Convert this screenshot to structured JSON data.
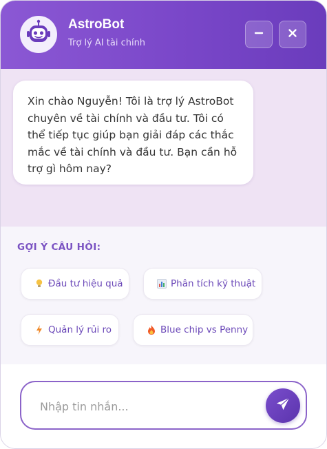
{
  "header": {
    "title": "AstroBot",
    "subtitle": "Trợ lý AI tài chính",
    "avatar_icon": "robot-icon",
    "minimize_icon": "minus-icon",
    "close_icon": "close-icon"
  },
  "messages": [
    {
      "sender": "bot",
      "text": "Xin chào Nguyễn! Tôi là trợ lý AstroBot chuyên về tài chính và đầu tư. Tôi có thể tiếp tục giúp bạn giải đáp các thắc mắc về tài chính và đầu tư. Bạn cần hỗ trợ gì hôm nay?"
    }
  ],
  "suggestions": {
    "label": "GỢI Ý CÂU HỎI:",
    "items": [
      {
        "label": "Đầu tư hiệu quả",
        "icon": "lightbulb-icon"
      },
      {
        "label": "Phân tích kỹ thuật",
        "icon": "bar-chart-icon"
      },
      {
        "label": "Quản lý rủi ro",
        "icon": "lightning-icon"
      },
      {
        "label": "Blue chip vs Penny",
        "icon": "fire-icon"
      }
    ]
  },
  "composer": {
    "placeholder": "Nhập tin nhắn...",
    "value": "",
    "send_icon": "send-icon"
  },
  "colors": {
    "header_start": "#8b58d4",
    "header_end": "#6a3cbc",
    "accent": "#7a52c2",
    "message_area_bg": "#efe3f4"
  }
}
